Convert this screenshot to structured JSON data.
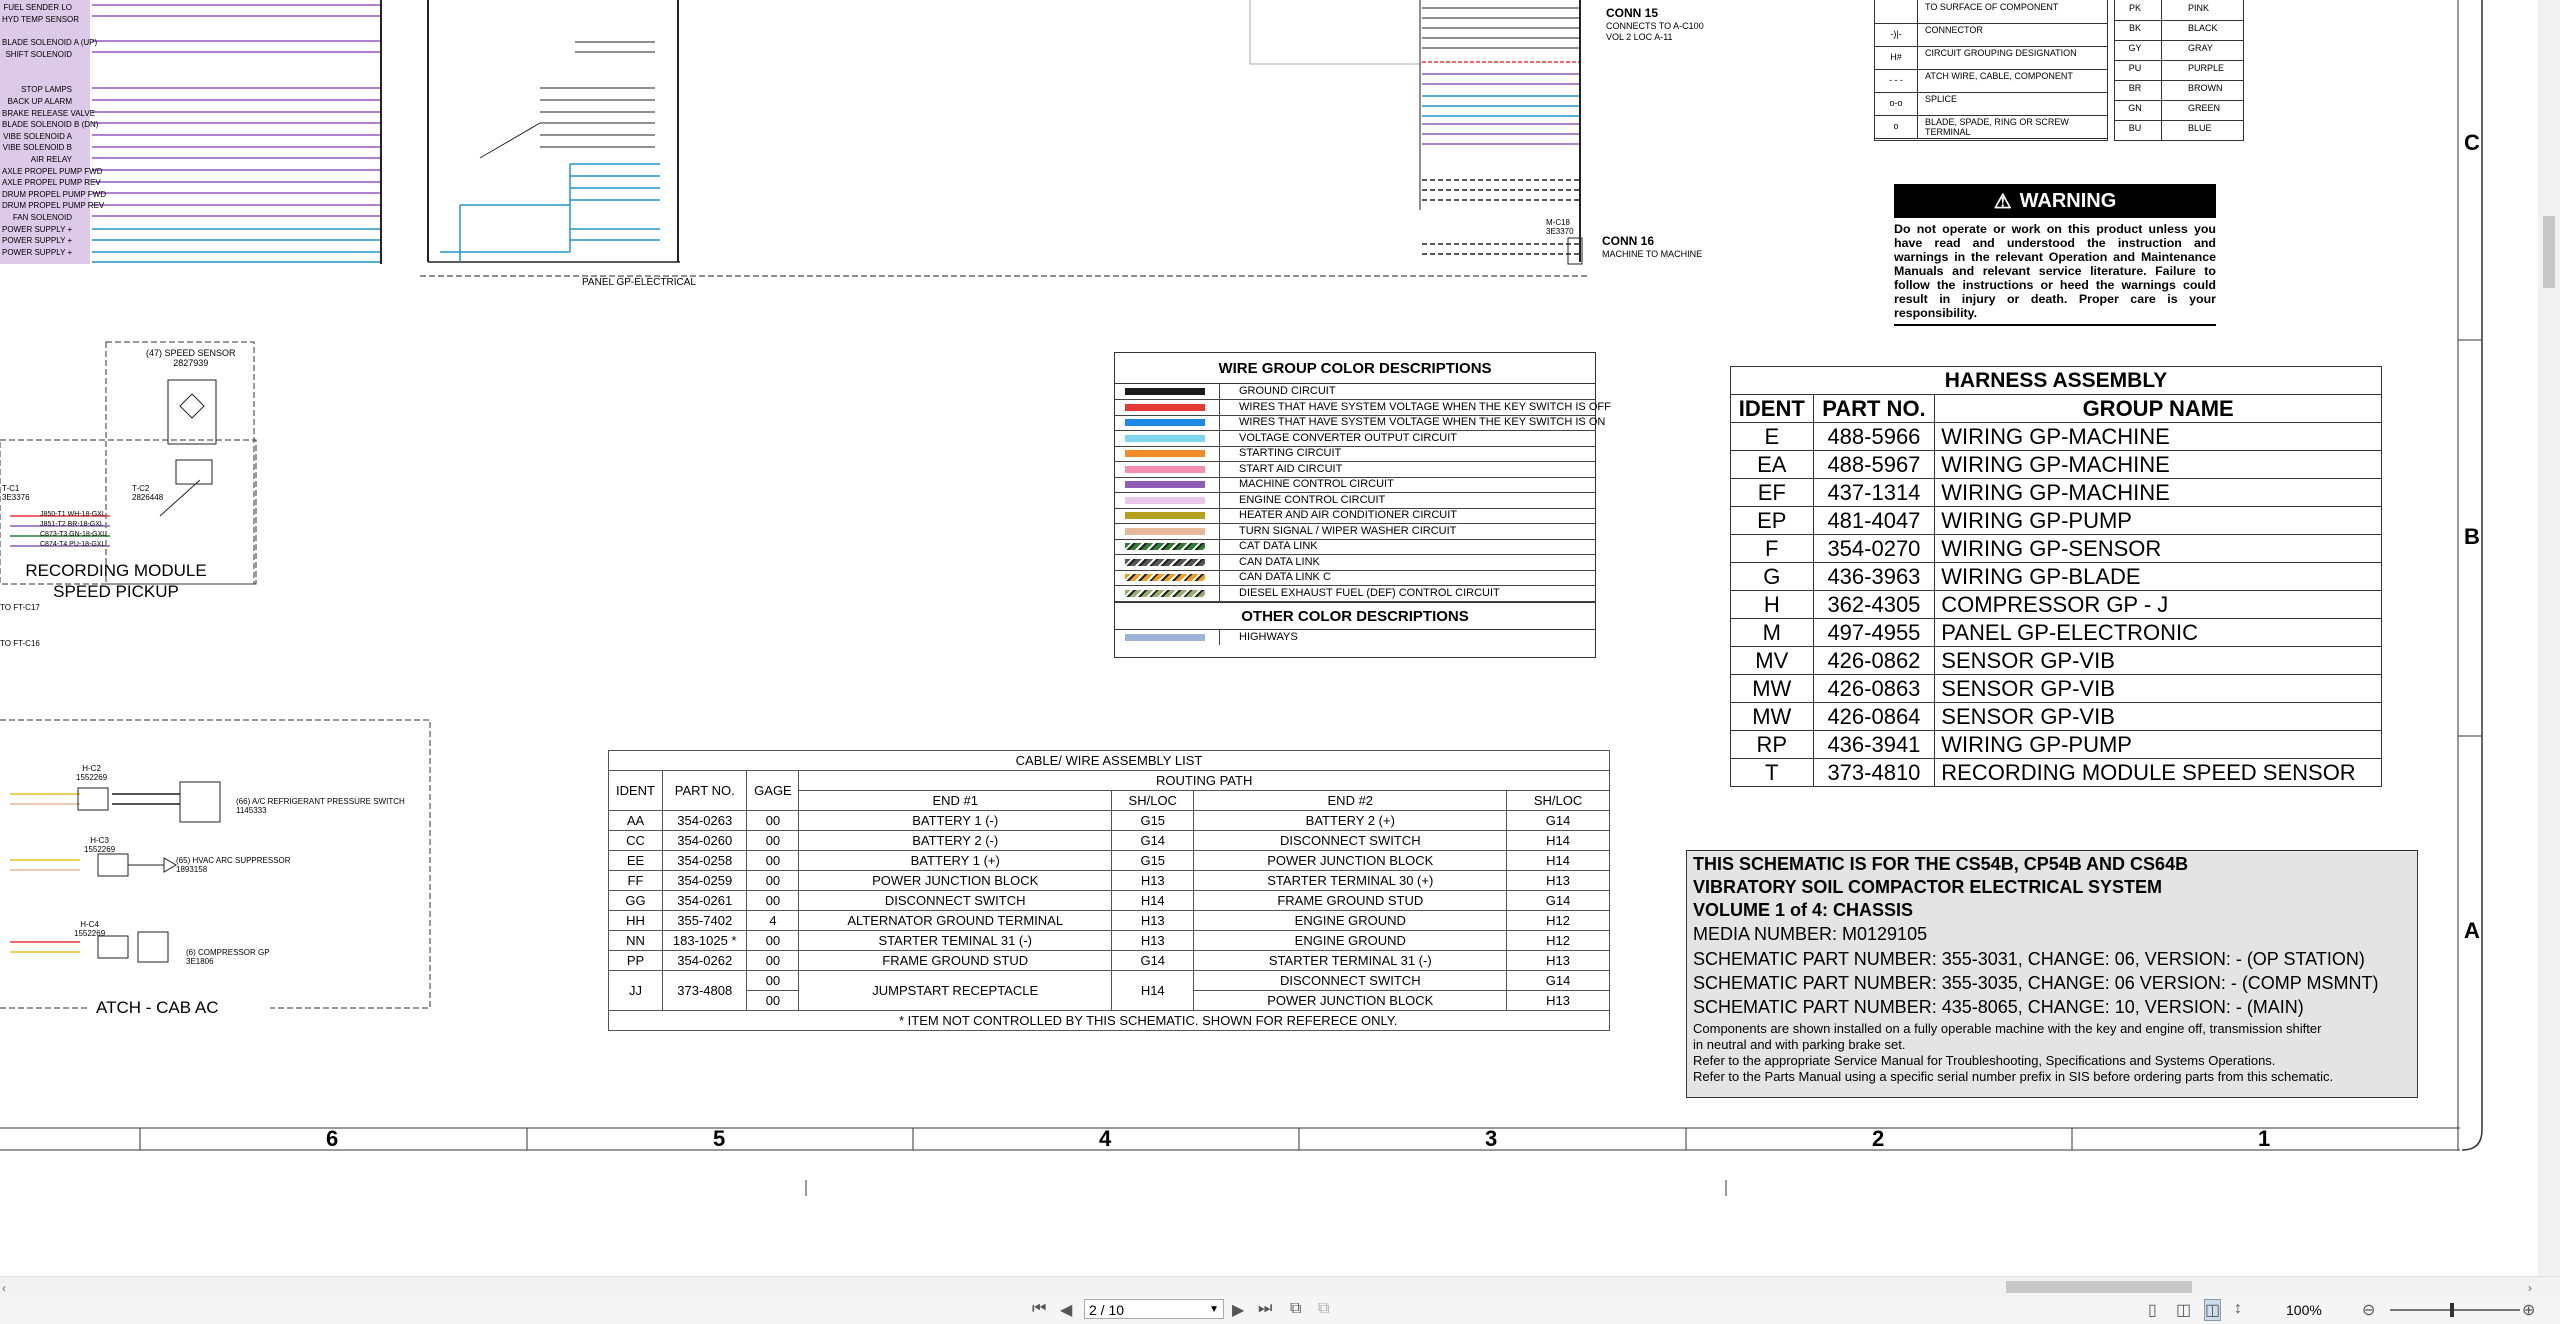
{
  "left_panel_labels": [
    "FUEL SENDER LO",
    "HYD TEMP SENSOR",
    "BLADE SOLENOID A (UP)",
    "SHIFT SOLENOID",
    "STOP LAMPS",
    "BACK UP ALARM",
    "BRAKE RELEASE VALVE",
    "BLADE SOLENOID B (DN)",
    "VIBE SOLENOID A",
    "VIBE SOLENOID B",
    "AIR RELAY",
    "AXLE PROPEL PUMP FWD",
    "AXLE PROPEL PUMP REV",
    "DRUM PROPEL PUMP FWD",
    "DRUM PROPEL PUMP REV",
    "FAN SOLENOID",
    "POWER SUPPLY +",
    "POWER SUPPLY +",
    "POWER SUPPLY +"
  ],
  "panel_label": "PANEL GP-ELECTRICAL",
  "conn15": {
    "title": "CONN 15",
    "line1": "CONNECTS TO A-C100",
    "line2": "VOL 2 LOC A-11"
  },
  "conn16": {
    "title": "CONN 16",
    "sub": "MACHINE TO MACHINE",
    "ref": "M-C18",
    "ref2": "3E3370"
  },
  "speed_sensor": {
    "title": "(47) SPEED SENSOR",
    "part": "2827939",
    "tc1": "T-C1",
    "tc1_part": "3E3376",
    "tc2": "T-C2",
    "tc2_part": "2826448",
    "wires": [
      "J850-T1  WH-18-GXL",
      "J851-T2  BR-18-GXL",
      "C873-T3  GN-18-GXL",
      "C874-T4  PU-18-GXL"
    ],
    "module_line1": "RECORDING MODULE",
    "module_line2": "SPEED PICKUP",
    "to1": "TO FT-C17",
    "to2": "TO FT-C16"
  },
  "cab_ac": {
    "title": "ATCH - CAB AC",
    "hc2": "H-C2",
    "hc2_part": "1552269",
    "hc3": "H-C3",
    "hc3_part": "1552269",
    "hc4": "H-C4",
    "hc4_part": "1552269",
    "p66": "(66) A/C REFRIGERANT PRESSURE SWITCH",
    "p66_part": "1145333",
    "p65": "(65) HVAC ARC SUPPRESSOR",
    "p65_part": "1893158",
    "p6": "(6) COMPRESSOR GP",
    "p6_part": "3E1806"
  },
  "legend_symbols": {
    "rows": [
      {
        "sym": "",
        "text": "TO SURFACE OF COMPONENT"
      },
      {
        "sym": "-)|-",
        "text": "CONNECTOR"
      },
      {
        "sym": "H#",
        "text": "CIRCUIT GROUPING DESIGNATION"
      },
      {
        "sym": "- - -",
        "text": "ATCH WIRE, CABLE, COMPONENT"
      },
      {
        "sym": "o-o",
        "text": "SPLICE"
      },
      {
        "sym": "o",
        "text": "BLADE, SPADE, RING OR SCREW TERMINAL"
      }
    ]
  },
  "color_codes": [
    {
      "code": "PK",
      "name": "PINK"
    },
    {
      "code": "BK",
      "name": "BLACK"
    },
    {
      "code": "GY",
      "name": "GRAY"
    },
    {
      "code": "PU",
      "name": "PURPLE"
    },
    {
      "code": "BR",
      "name": "BROWN"
    },
    {
      "code": "GN",
      "name": "GREEN"
    },
    {
      "code": "BU",
      "name": "BLUE"
    }
  ],
  "warning": {
    "title": "WARNING",
    "text": "Do not operate or work on this product unless you have read and understood the instruction and warnings in the relevant Operation and Maintenance Manuals and relevant service literature. Failure to follow the instructions or heed the warnings could result in injury or death. Proper care is your responsibility."
  },
  "wire_group": {
    "title": "WIRE GROUP COLOR DESCRIPTIONS",
    "items": [
      {
        "color": "#1a1a1a",
        "pattern": "",
        "label": "GROUND CIRCUIT"
      },
      {
        "color": "#e53935",
        "pattern": "",
        "label": "WIRES THAT HAVE SYSTEM VOLTAGE WHEN THE KEY SWITCH IS OFF"
      },
      {
        "color": "#1e88e5",
        "pattern": "",
        "label": "WIRES THAT HAVE SYSTEM VOLTAGE WHEN THE KEY SWITCH IS ON"
      },
      {
        "color": "#80d8f0",
        "pattern": "",
        "label": "VOLTAGE CONVERTER OUTPUT CIRCUIT"
      },
      {
        "color": "#f28c28",
        "pattern": "",
        "label": "STARTING CIRCUIT"
      },
      {
        "color": "#f48fb1",
        "pattern": "",
        "label": "START AID CIRCUIT"
      },
      {
        "color": "#8e5bb5",
        "pattern": "",
        "label": "MACHINE CONTROL CIRCUIT"
      },
      {
        "color": "#e8c8e8",
        "pattern": "",
        "label": "ENGINE CONTROL CIRCUIT"
      },
      {
        "color": "#b5a01e",
        "pattern": "",
        "label": "HEATER AND AIR CONDITIONER CIRCUIT"
      },
      {
        "color": "#e8b89a",
        "pattern": "",
        "label": "TURN SIGNAL / WIPER WASHER CIRCUIT"
      },
      {
        "color": "#2e7d32",
        "pattern": "stripe",
        "label": "CAT DATA LINK"
      },
      {
        "color": "#555555",
        "pattern": "stripe",
        "label": "CAN DATA LINK"
      },
      {
        "color": "#f0a020",
        "pattern": "stripe",
        "label": "CAN DATA LINK C"
      },
      {
        "color": "#9ab070",
        "pattern": "stripe",
        "label": "DIESEL EXHAUST FUEL (DEF) CONTROL CIRCUIT"
      }
    ],
    "other_title": "OTHER COLOR DESCRIPTIONS",
    "other_items": [
      {
        "color": "#9db4d6",
        "label": "HIGHWAYS"
      }
    ]
  },
  "harness": {
    "title": "HARNESS ASSEMBLY",
    "headers": [
      "IDENT",
      "PART NO.",
      "GROUP NAME"
    ],
    "rows": [
      [
        "E",
        "488-5966",
        "WIRING GP-MACHINE"
      ],
      [
        "EA",
        "488-5967",
        "WIRING GP-MACHINE"
      ],
      [
        "EF",
        "437-1314",
        "WIRING GP-MACHINE"
      ],
      [
        "EP",
        "481-4047",
        "WIRING GP-PUMP"
      ],
      [
        "F",
        "354-0270",
        "WIRING GP-SENSOR"
      ],
      [
        "G",
        "436-3963",
        "WIRING GP-BLADE"
      ],
      [
        "H",
        "362-4305",
        "COMPRESSOR GP - J"
      ],
      [
        "M",
        "497-4955",
        "PANEL GP-ELECTRONIC"
      ],
      [
        "MV",
        "426-0862",
        "SENSOR GP-VIB"
      ],
      [
        "MW",
        "426-0863",
        "SENSOR GP-VIB"
      ],
      [
        "MW",
        "426-0864",
        "SENSOR GP-VIB"
      ],
      [
        "RP",
        "436-3941",
        "WIRING GP-PUMP"
      ],
      [
        "T",
        "373-4810",
        "RECORDING MODULE SPEED SENSOR"
      ]
    ]
  },
  "cable": {
    "title": "CABLE/ WIRE ASSEMBLY LIST",
    "h_ident": "IDENT",
    "h_part": "PART NO.",
    "h_gage": "GAGE",
    "h_routing": "ROUTING PATH",
    "h_end1": "END #1",
    "h_shloc1": "SH/LOC",
    "h_end2": "END #2",
    "h_shloc2": "SH/LOC",
    "rows": [
      [
        "AA",
        "354-0263",
        "00",
        "BATTERY 1 (-)",
        "G15",
        "BATTERY 2 (+)",
        "G14"
      ],
      [
        "CC",
        "354-0260",
        "00",
        "BATTERY 2 (-)",
        "G14",
        "DISCONNECT SWITCH",
        "H14"
      ],
      [
        "EE",
        "354-0258",
        "00",
        "BATTERY 1 (+)",
        "G15",
        "POWER JUNCTION BLOCK",
        "H14"
      ],
      [
        "FF",
        "354-0259",
        "00",
        "POWER JUNCTION BLOCK",
        "H13",
        "STARTER TERMINAL 30 (+)",
        "H13"
      ],
      [
        "GG",
        "354-0261",
        "00",
        "DISCONNECT SWITCH",
        "H14",
        "FRAME GROUND STUD",
        "G14"
      ],
      [
        "HH",
        "355-7402",
        "4",
        "ALTERNATOR GROUND TERMINAL",
        "H13",
        "ENGINE GROUND",
        "H12"
      ],
      [
        "NN",
        "183-1025 *",
        "00",
        "STARTER TEMINAL 31 (-)",
        "H13",
        "ENGINE GROUND",
        "H12"
      ],
      [
        "PP",
        "354-0262",
        "00",
        "FRAME GROUND STUD",
        "G14",
        "STARTER TERMINAL 31 (-)",
        "H13"
      ]
    ],
    "jj": {
      "ident": "JJ",
      "part": "373-4808",
      "gage1": "00",
      "gage2": "00",
      "end1": "JUMPSTART RECEPTACLE",
      "shloc1": "H14",
      "end2a": "DISCONNECT SWITCH",
      "shloc2a": "G14",
      "end2b": "POWER JUNCTION BLOCK",
      "shloc2b": "H13"
    },
    "footnote": "*   ITEM NOT CONTROLLED BY THIS SCHEMATIC.  SHOWN FOR REFERECE ONLY."
  },
  "title_block": {
    "line1": "THIS SCHEMATIC IS FOR THE CS54B, CP54B AND CS64B",
    "line2": "VIBRATORY SOIL COMPACTOR ELECTRICAL SYSTEM",
    "line3": "VOLUME 1 of 4: CHASSIS",
    "media": "MEDIA NUMBER: M0129105",
    "sp1": "SCHEMATIC PART NUMBER: 355-3031, CHANGE: 06, VERSION: - (OP STATION)",
    "sp2": "SCHEMATIC PART NUMBER: 355-3035, CHANGE: 06 VERSION: - (COMP MSMNT)",
    "sp3": "SCHEMATIC PART NUMBER: 435-8065, CHANGE: 10, VERSION: - (MAIN)",
    "note1": "Components are shown installed on a fully operable machine with the key and engine off, transmission shifter",
    "note2": "in neutral and with parking brake set.",
    "note3": "Refer to the appropriate Service Manual for Troubleshooting, Specifications and Systems Operations.",
    "note4": "Refer to the Parts Manual using a specific serial number prefix in SIS before ordering parts from this schematic."
  },
  "grid": {
    "columns": [
      "6",
      "5",
      "4",
      "3",
      "2",
      "1"
    ],
    "rows": [
      "C",
      "B",
      "A"
    ]
  },
  "viewer": {
    "page_value": "2 / 10",
    "zoom": "100%"
  }
}
